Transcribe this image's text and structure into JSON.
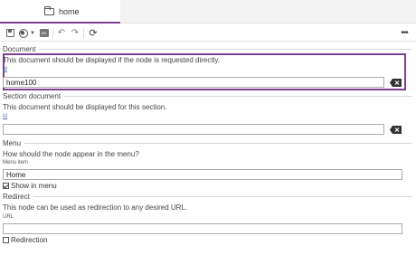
{
  "tab": {
    "label": "home",
    "icon": "folder-icon"
  },
  "toolbar": {
    "icons": [
      "save-icon",
      "globe-icon",
      "caret-down-icon",
      "language-icon",
      "undo-icon",
      "redo-icon",
      "refresh-icon",
      "more-icon"
    ],
    "lang_badge": "EN"
  },
  "document": {
    "title": "Document",
    "description": "This document should be displayed if the node is requested directly.",
    "id_label": "Id",
    "id_value": "home100"
  },
  "section_document": {
    "title": "Section document",
    "description": "This document should be displayed for this section.",
    "id_label": "Id",
    "id_value": ""
  },
  "menu": {
    "title": "Menu",
    "description": "How should the node appear in the menu?",
    "item_label": "Menu item",
    "item_value": "Home",
    "show_label": "Show in menu",
    "show_checked": true
  },
  "redirect": {
    "title": "Redirect",
    "description": "This node can be used as redirection to any desired URL.",
    "url_label": "URL",
    "url_value": "",
    "redirection_label": "Redirection",
    "redirection_checked": false
  },
  "colors": {
    "accent": "#7e3f8f",
    "link": "#4a6fb5"
  }
}
